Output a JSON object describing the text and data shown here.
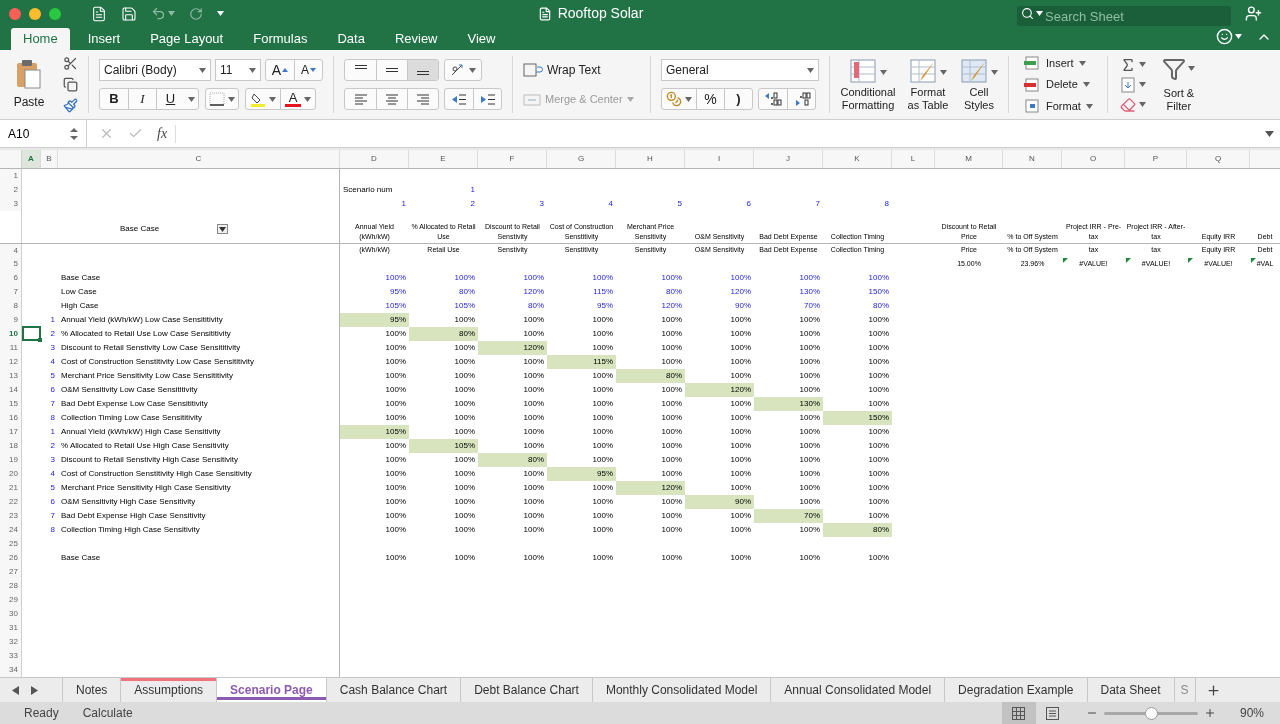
{
  "window": {
    "title": "Rooftop Solar"
  },
  "search": {
    "placeholder": "Search Sheet"
  },
  "ribbon_tabs": [
    {
      "label": "Home",
      "selected": true
    },
    {
      "label": "Insert",
      "selected": false
    },
    {
      "label": "Page Layout",
      "selected": false
    },
    {
      "label": "Formulas",
      "selected": false
    },
    {
      "label": "Data",
      "selected": false
    },
    {
      "label": "Review",
      "selected": false
    },
    {
      "label": "View",
      "selected": false
    }
  ],
  "ribbon": {
    "paste": "Paste",
    "font_name": "Calibri (Body)",
    "font_size": "11",
    "grow_font": "A",
    "shrink_font": "A",
    "bold": "B",
    "italic": "I",
    "underline": "U",
    "font_color": "A",
    "vertical_alignment": [
      {
        "selected": false
      },
      {
        "selected": false
      },
      {
        "selected": true
      }
    ],
    "wrap_text": "Wrap Text",
    "merge": {
      "label": "Merge & Center",
      "disabled": true
    },
    "number_format": "General",
    "percent": "%",
    "comma": ")",
    "styles": [
      "Conditional Formatting",
      "Format as Table",
      "Cell Styles"
    ],
    "cells": [
      "Insert",
      "Delete",
      "Format"
    ],
    "sort_filter": "Sort & Filter"
  },
  "formula_bar": {
    "cell_ref": "A10",
    "function_label": "fx"
  },
  "sheet": {
    "columns": [
      {
        "letter": "A",
        "selected": true
      },
      {
        "letter": "B",
        "selected": false
      },
      {
        "letter": "C",
        "selected": false
      },
      {
        "letter": "D",
        "selected": false
      },
      {
        "letter": "E",
        "selected": false
      },
      {
        "letter": "F",
        "selected": false
      },
      {
        "letter": "G",
        "selected": false
      },
      {
        "letter": "H",
        "selected": false
      },
      {
        "letter": "I",
        "selected": false
      },
      {
        "letter": "J",
        "selected": false
      },
      {
        "letter": "K",
        "selected": false
      },
      {
        "letter": "L",
        "selected": false
      },
      {
        "letter": "M",
        "selected": false
      },
      {
        "letter": "N",
        "selected": false
      },
      {
        "letter": "O",
        "selected": false
      },
      {
        "letter": "P",
        "selected": false
      },
      {
        "letter": "Q",
        "selected": false
      }
    ],
    "top_rows": [
      {
        "number": "1"
      },
      {
        "number": "2",
        "cells": {
          "D": {
            "text": "Scenario num",
            "kind": "label",
            "input": false
          },
          "E": {
            "text": "1",
            "kind": "number",
            "input": true
          }
        }
      },
      {
        "number": "3",
        "cells": {
          "D": {
            "text": "1",
            "kind": "number",
            "input": true
          },
          "E": {
            "text": "2",
            "kind": "number",
            "input": true
          },
          "F": {
            "text": "3",
            "kind": "number",
            "input": true
          },
          "G": {
            "text": "4",
            "kind": "number",
            "input": true
          },
          "H": {
            "text": "5",
            "kind": "number",
            "input": true
          },
          "I": {
            "text": "6",
            "kind": "number",
            "input": true
          },
          "J": {
            "text": "7",
            "kind": "number",
            "input": true
          },
          "K": {
            "text": "8",
            "kind": "number",
            "input": true
          }
        }
      }
    ],
    "filter_label": "Base Case",
    "headers": {
      "D": "Annual Yield (kWh/kW)",
      "E": "% Allocated to Retail Use",
      "F": "Discount to Retail Senstivity",
      "G": "Cost of Construction Senstitivity",
      "H": "Merchant Price Sensitivity",
      "I": "O&M Sensitivity",
      "J": "Bad Debt Expense",
      "K": "Collection Timing",
      "M": "Discount to Retail Price",
      "N": "% to Off System",
      "O": "Project IRR - Pre-tax",
      "P": "Project IRR - After-tax",
      "Q": "Equity IRR",
      "R": "Debt"
    },
    "row4": {
      "number": "4",
      "cells": {
        "D": "(kWh/kW)",
        "E": "Retail Use",
        "F": "Senstivity",
        "G": "Senstitivity",
        "H": "Sensitivity",
        "I": "O&M Sensitivity",
        "J": "Bad Debt Expense",
        "K": "Collection Timing",
        "M": "Price",
        "N": "% to Off System",
        "O": "tax",
        "P": "tax",
        "Q": "Equity IRR",
        "R": "Debt"
      }
    },
    "row5": {
      "number": "5",
      "cells": {
        "M": {
          "text": "15.00%",
          "flagged": false
        },
        "N": {
          "text": "23.96%",
          "flagged": false
        },
        "O": {
          "text": "#VALUE!",
          "flagged": true
        },
        "P": {
          "text": "#VALUE!",
          "flagged": true
        },
        "Q": {
          "text": "#VALUE!",
          "flagged": true
        },
        "R": {
          "text": "#VAL",
          "flagged": true
        }
      }
    },
    "rows": [
      {
        "number": "6",
        "selected": false,
        "label": "Base Case",
        "input": true,
        "values": [
          {
            "text": "100%",
            "highlighted": false
          },
          {
            "text": "100%",
            "highlighted": false
          },
          {
            "text": "100%",
            "highlighted": false
          },
          {
            "text": "100%",
            "highlighted": false
          },
          {
            "text": "100%",
            "highlighted": false
          },
          {
            "text": "100%",
            "highlighted": false
          },
          {
            "text": "100%",
            "highlighted": false
          },
          {
            "text": "100%",
            "highlighted": false
          }
        ]
      },
      {
        "number": "7",
        "selected": false,
        "label": "Low Case",
        "input": true,
        "values": [
          {
            "text": "95%",
            "highlighted": false
          },
          {
            "text": "80%",
            "highlighted": false
          },
          {
            "text": "120%",
            "highlighted": false
          },
          {
            "text": "115%",
            "highlighted": false
          },
          {
            "text": "80%",
            "highlighted": false
          },
          {
            "text": "120%",
            "highlighted": false
          },
          {
            "text": "130%",
            "highlighted": false
          },
          {
            "text": "150%",
            "highlighted": false
          }
        ]
      },
      {
        "number": "8",
        "selected": false,
        "label": "High Case",
        "input": true,
        "values": [
          {
            "text": "105%",
            "highlighted": false
          },
          {
            "text": "105%",
            "highlighted": false
          },
          {
            "text": "80%",
            "highlighted": false
          },
          {
            "text": "95%",
            "highlighted": false
          },
          {
            "text": "120%",
            "highlighted": false
          },
          {
            "text": "90%",
            "highlighted": false
          },
          {
            "text": "70%",
            "highlighted": false
          },
          {
            "text": "80%",
            "highlighted": false
          }
        ]
      },
      {
        "number": "9",
        "selected": false,
        "index": "1",
        "label": "Annual Yield (kWh/kW) Low Case Sensititivity",
        "input": false,
        "values": [
          {
            "text": "95%",
            "highlighted": true
          },
          {
            "text": "100%",
            "highlighted": false
          },
          {
            "text": "100%",
            "highlighted": false
          },
          {
            "text": "100%",
            "highlighted": false
          },
          {
            "text": "100%",
            "highlighted": false
          },
          {
            "text": "100%",
            "highlighted": false
          },
          {
            "text": "100%",
            "highlighted": false
          },
          {
            "text": "100%",
            "highlighted": false
          }
        ]
      },
      {
        "number": "10",
        "selected": true,
        "index": "2",
        "label": "% Allocated to Retail Use Low Case Sensititivity",
        "input": false,
        "values": [
          {
            "text": "100%",
            "highlighted": false
          },
          {
            "text": "80%",
            "highlighted": true
          },
          {
            "text": "100%",
            "highlighted": false
          },
          {
            "text": "100%",
            "highlighted": false
          },
          {
            "text": "100%",
            "highlighted": false
          },
          {
            "text": "100%",
            "highlighted": false
          },
          {
            "text": "100%",
            "highlighted": false
          },
          {
            "text": "100%",
            "highlighted": false
          }
        ]
      },
      {
        "number": "11",
        "selected": false,
        "index": "3",
        "label": "Discount to Retail Senstivity Low Case Sensititivity",
        "input": false,
        "values": [
          {
            "text": "100%",
            "highlighted": false
          },
          {
            "text": "100%",
            "highlighted": false
          },
          {
            "text": "120%",
            "highlighted": true
          },
          {
            "text": "100%",
            "highlighted": false
          },
          {
            "text": "100%",
            "highlighted": false
          },
          {
            "text": "100%",
            "highlighted": false
          },
          {
            "text": "100%",
            "highlighted": false
          },
          {
            "text": "100%",
            "highlighted": false
          }
        ]
      },
      {
        "number": "12",
        "selected": false,
        "index": "4",
        "label": "Cost of Construction Senstitivity Low Case Sensititivity",
        "input": false,
        "values": [
          {
            "text": "100%",
            "highlighted": false
          },
          {
            "text": "100%",
            "highlighted": false
          },
          {
            "text": "100%",
            "highlighted": false
          },
          {
            "text": "115%",
            "highlighted": true
          },
          {
            "text": "100%",
            "highlighted": false
          },
          {
            "text": "100%",
            "highlighted": false
          },
          {
            "text": "100%",
            "highlighted": false
          },
          {
            "text": "100%",
            "highlighted": false
          }
        ]
      },
      {
        "number": "13",
        "selected": false,
        "index": "5",
        "label": "Merchant Price Sensitivity Low Case Sensititivity",
        "input": false,
        "values": [
          {
            "text": "100%",
            "highlighted": false
          },
          {
            "text": "100%",
            "highlighted": false
          },
          {
            "text": "100%",
            "highlighted": false
          },
          {
            "text": "100%",
            "highlighted": false
          },
          {
            "text": "80%",
            "highlighted": true
          },
          {
            "text": "100%",
            "highlighted": false
          },
          {
            "text": "100%",
            "highlighted": false
          },
          {
            "text": "100%",
            "highlighted": false
          }
        ]
      },
      {
        "number": "14",
        "selected": false,
        "index": "6",
        "label": "O&M Sensitivity Low Case Sensititivity",
        "input": false,
        "values": [
          {
            "text": "100%",
            "highlighted": false
          },
          {
            "text": "100%",
            "highlighted": false
          },
          {
            "text": "100%",
            "highlighted": false
          },
          {
            "text": "100%",
            "highlighted": false
          },
          {
            "text": "100%",
            "highlighted": false
          },
          {
            "text": "120%",
            "highlighted": true
          },
          {
            "text": "100%",
            "highlighted": false
          },
          {
            "text": "100%",
            "highlighted": false
          }
        ]
      },
      {
        "number": "15",
        "selected": false,
        "index": "7",
        "label": "Bad Debt Expense Low Case Sensititivity",
        "input": false,
        "values": [
          {
            "text": "100%",
            "highlighted": false
          },
          {
            "text": "100%",
            "highlighted": false
          },
          {
            "text": "100%",
            "highlighted": false
          },
          {
            "text": "100%",
            "highlighted": false
          },
          {
            "text": "100%",
            "highlighted": false
          },
          {
            "text": "100%",
            "highlighted": false
          },
          {
            "text": "130%",
            "highlighted": true
          },
          {
            "text": "100%",
            "highlighted": false
          }
        ]
      },
      {
        "number": "16",
        "selected": false,
        "index": "8",
        "label": "Collection Timing Low Case Sensititivity",
        "input": false,
        "values": [
          {
            "text": "100%",
            "highlighted": false
          },
          {
            "text": "100%",
            "highlighted": false
          },
          {
            "text": "100%",
            "highlighted": false
          },
          {
            "text": "100%",
            "highlighted": false
          },
          {
            "text": "100%",
            "highlighted": false
          },
          {
            "text": "100%",
            "highlighted": false
          },
          {
            "text": "100%",
            "highlighted": false
          },
          {
            "text": "150%",
            "highlighted": true
          }
        ]
      },
      {
        "number": "17",
        "selected": false,
        "index": "1",
        "label": "Annual Yield (kWh/kW) High Case Sensitivity",
        "input": false,
        "values": [
          {
            "text": "105%",
            "highlighted": true
          },
          {
            "text": "100%",
            "highlighted": false
          },
          {
            "text": "100%",
            "highlighted": false
          },
          {
            "text": "100%",
            "highlighted": false
          },
          {
            "text": "100%",
            "highlighted": false
          },
          {
            "text": "100%",
            "highlighted": false
          },
          {
            "text": "100%",
            "highlighted": false
          },
          {
            "text": "100%",
            "highlighted": false
          }
        ]
      },
      {
        "number": "18",
        "selected": false,
        "index": "2",
        "label": "% Allocated to Retail Use High Case Sensitivity",
        "input": false,
        "values": [
          {
            "text": "100%",
            "highlighted": false
          },
          {
            "text": "105%",
            "highlighted": true
          },
          {
            "text": "100%",
            "highlighted": false
          },
          {
            "text": "100%",
            "highlighted": false
          },
          {
            "text": "100%",
            "highlighted": false
          },
          {
            "text": "100%",
            "highlighted": false
          },
          {
            "text": "100%",
            "highlighted": false
          },
          {
            "text": "100%",
            "highlighted": false
          }
        ]
      },
      {
        "number": "19",
        "selected": false,
        "index": "3",
        "label": "Discount to Retail Senstivity High Case Sensitivity",
        "input": false,
        "values": [
          {
            "text": "100%",
            "highlighted": false
          },
          {
            "text": "100%",
            "highlighted": false
          },
          {
            "text": "80%",
            "highlighted": true
          },
          {
            "text": "100%",
            "highlighted": false
          },
          {
            "text": "100%",
            "highlighted": false
          },
          {
            "text": "100%",
            "highlighted": false
          },
          {
            "text": "100%",
            "highlighted": false
          },
          {
            "text": "100%",
            "highlighted": false
          }
        ]
      },
      {
        "number": "20",
        "selected": false,
        "index": "4",
        "label": "Cost of Construction Senstitivity High Case Sensitivity",
        "input": false,
        "values": [
          {
            "text": "100%",
            "highlighted": false
          },
          {
            "text": "100%",
            "highlighted": false
          },
          {
            "text": "100%",
            "highlighted": false
          },
          {
            "text": "95%",
            "highlighted": true
          },
          {
            "text": "100%",
            "highlighted": false
          },
          {
            "text": "100%",
            "highlighted": false
          },
          {
            "text": "100%",
            "highlighted": false
          },
          {
            "text": "100%",
            "highlighted": false
          }
        ]
      },
      {
        "number": "21",
        "selected": false,
        "index": "5",
        "label": "Merchant Price Sensitivity High Case Sensitivity",
        "input": false,
        "values": [
          {
            "text": "100%",
            "highlighted": false
          },
          {
            "text": "100%",
            "highlighted": false
          },
          {
            "text": "100%",
            "highlighted": false
          },
          {
            "text": "100%",
            "highlighted": false
          },
          {
            "text": "120%",
            "highlighted": true
          },
          {
            "text": "100%",
            "highlighted": false
          },
          {
            "text": "100%",
            "highlighted": false
          },
          {
            "text": "100%",
            "highlighted": false
          }
        ]
      },
      {
        "number": "22",
        "selected": false,
        "index": "6",
        "label": "O&M Sensitivity High Case Sensitivity",
        "input": false,
        "values": [
          {
            "text": "100%",
            "highlighted": false
          },
          {
            "text": "100%",
            "highlighted": false
          },
          {
            "text": "100%",
            "highlighted": false
          },
          {
            "text": "100%",
            "highlighted": false
          },
          {
            "text": "100%",
            "highlighted": false
          },
          {
            "text": "90%",
            "highlighted": true
          },
          {
            "text": "100%",
            "highlighted": false
          },
          {
            "text": "100%",
            "highlighted": false
          }
        ]
      },
      {
        "number": "23",
        "selected": false,
        "index": "7",
        "label": "Bad Debt Expense High Case Sensitivity",
        "input": false,
        "values": [
          {
            "text": "100%",
            "highlighted": false
          },
          {
            "text": "100%",
            "highlighted": false
          },
          {
            "text": "100%",
            "highlighted": false
          },
          {
            "text": "100%",
            "highlighted": false
          },
          {
            "text": "100%",
            "highlighted": false
          },
          {
            "text": "100%",
            "highlighted": false
          },
          {
            "text": "70%",
            "highlighted": true
          },
          {
            "text": "100%",
            "highlighted": false
          }
        ]
      },
      {
        "number": "24",
        "selected": false,
        "index": "8",
        "label": "Collection Timing High Case Sensitivity",
        "input": false,
        "values": [
          {
            "text": "100%",
            "highlighted": false
          },
          {
            "text": "100%",
            "highlighted": false
          },
          {
            "text": "100%",
            "highlighted": false
          },
          {
            "text": "100%",
            "highlighted": false
          },
          {
            "text": "100%",
            "highlighted": false
          },
          {
            "text": "100%",
            "highlighted": false
          },
          {
            "text": "100%",
            "highlighted": false
          },
          {
            "text": "80%",
            "highlighted": true
          }
        ]
      },
      {
        "number": "25",
        "selected": false
      },
      {
        "number": "26",
        "selected": false,
        "label": "Base Case",
        "input": false,
        "values": [
          {
            "text": "100%",
            "highlighted": false
          },
          {
            "text": "100%",
            "highlighted": false
          },
          {
            "text": "100%",
            "highlighted": false
          },
          {
            "text": "100%",
            "highlighted": false
          },
          {
            "text": "100%",
            "highlighted": false
          },
          {
            "text": "100%",
            "highlighted": false
          },
          {
            "text": "100%",
            "highlighted": false
          },
          {
            "text": "100%",
            "highlighted": false
          }
        ]
      },
      {
        "number": "27",
        "selected": false
      },
      {
        "number": "28",
        "selected": false
      },
      {
        "number": "29",
        "selected": false
      },
      {
        "number": "30",
        "selected": false
      },
      {
        "number": "31",
        "selected": false
      },
      {
        "number": "32",
        "selected": false
      },
      {
        "number": "33",
        "selected": false
      },
      {
        "number": "34",
        "selected": false
      }
    ]
  },
  "sheet_tabs": [
    {
      "label": "Notes",
      "selected": false,
      "faded": false
    },
    {
      "label": "Assumptions",
      "selected": false,
      "faded": false,
      "color": "#f0727c"
    },
    {
      "label": "Scenario Page",
      "selected": true,
      "faded": false,
      "color": "#8e5ab0"
    },
    {
      "label": "Cash Balance Chart",
      "selected": false,
      "faded": false
    },
    {
      "label": "Debt Balance Chart",
      "selected": false,
      "faded": false
    },
    {
      "label": "Monthly Consolidated Model",
      "selected": false,
      "faded": false
    },
    {
      "label": "Annual Consolidated Model",
      "selected": false,
      "faded": false
    },
    {
      "label": "Degradation Example",
      "selected": false,
      "faded": false
    },
    {
      "label": "Data Sheet",
      "selected": false,
      "faded": false
    },
    {
      "label": "S",
      "selected": false,
      "faded": true
    }
  ],
  "status_bar": {
    "mode": "Ready",
    "calculate": "Calculate",
    "views": [
      {
        "selected": true
      },
      {
        "selected": false
      }
    ],
    "zoom": {
      "level": 0.5,
      "reading": "90%"
    }
  }
}
